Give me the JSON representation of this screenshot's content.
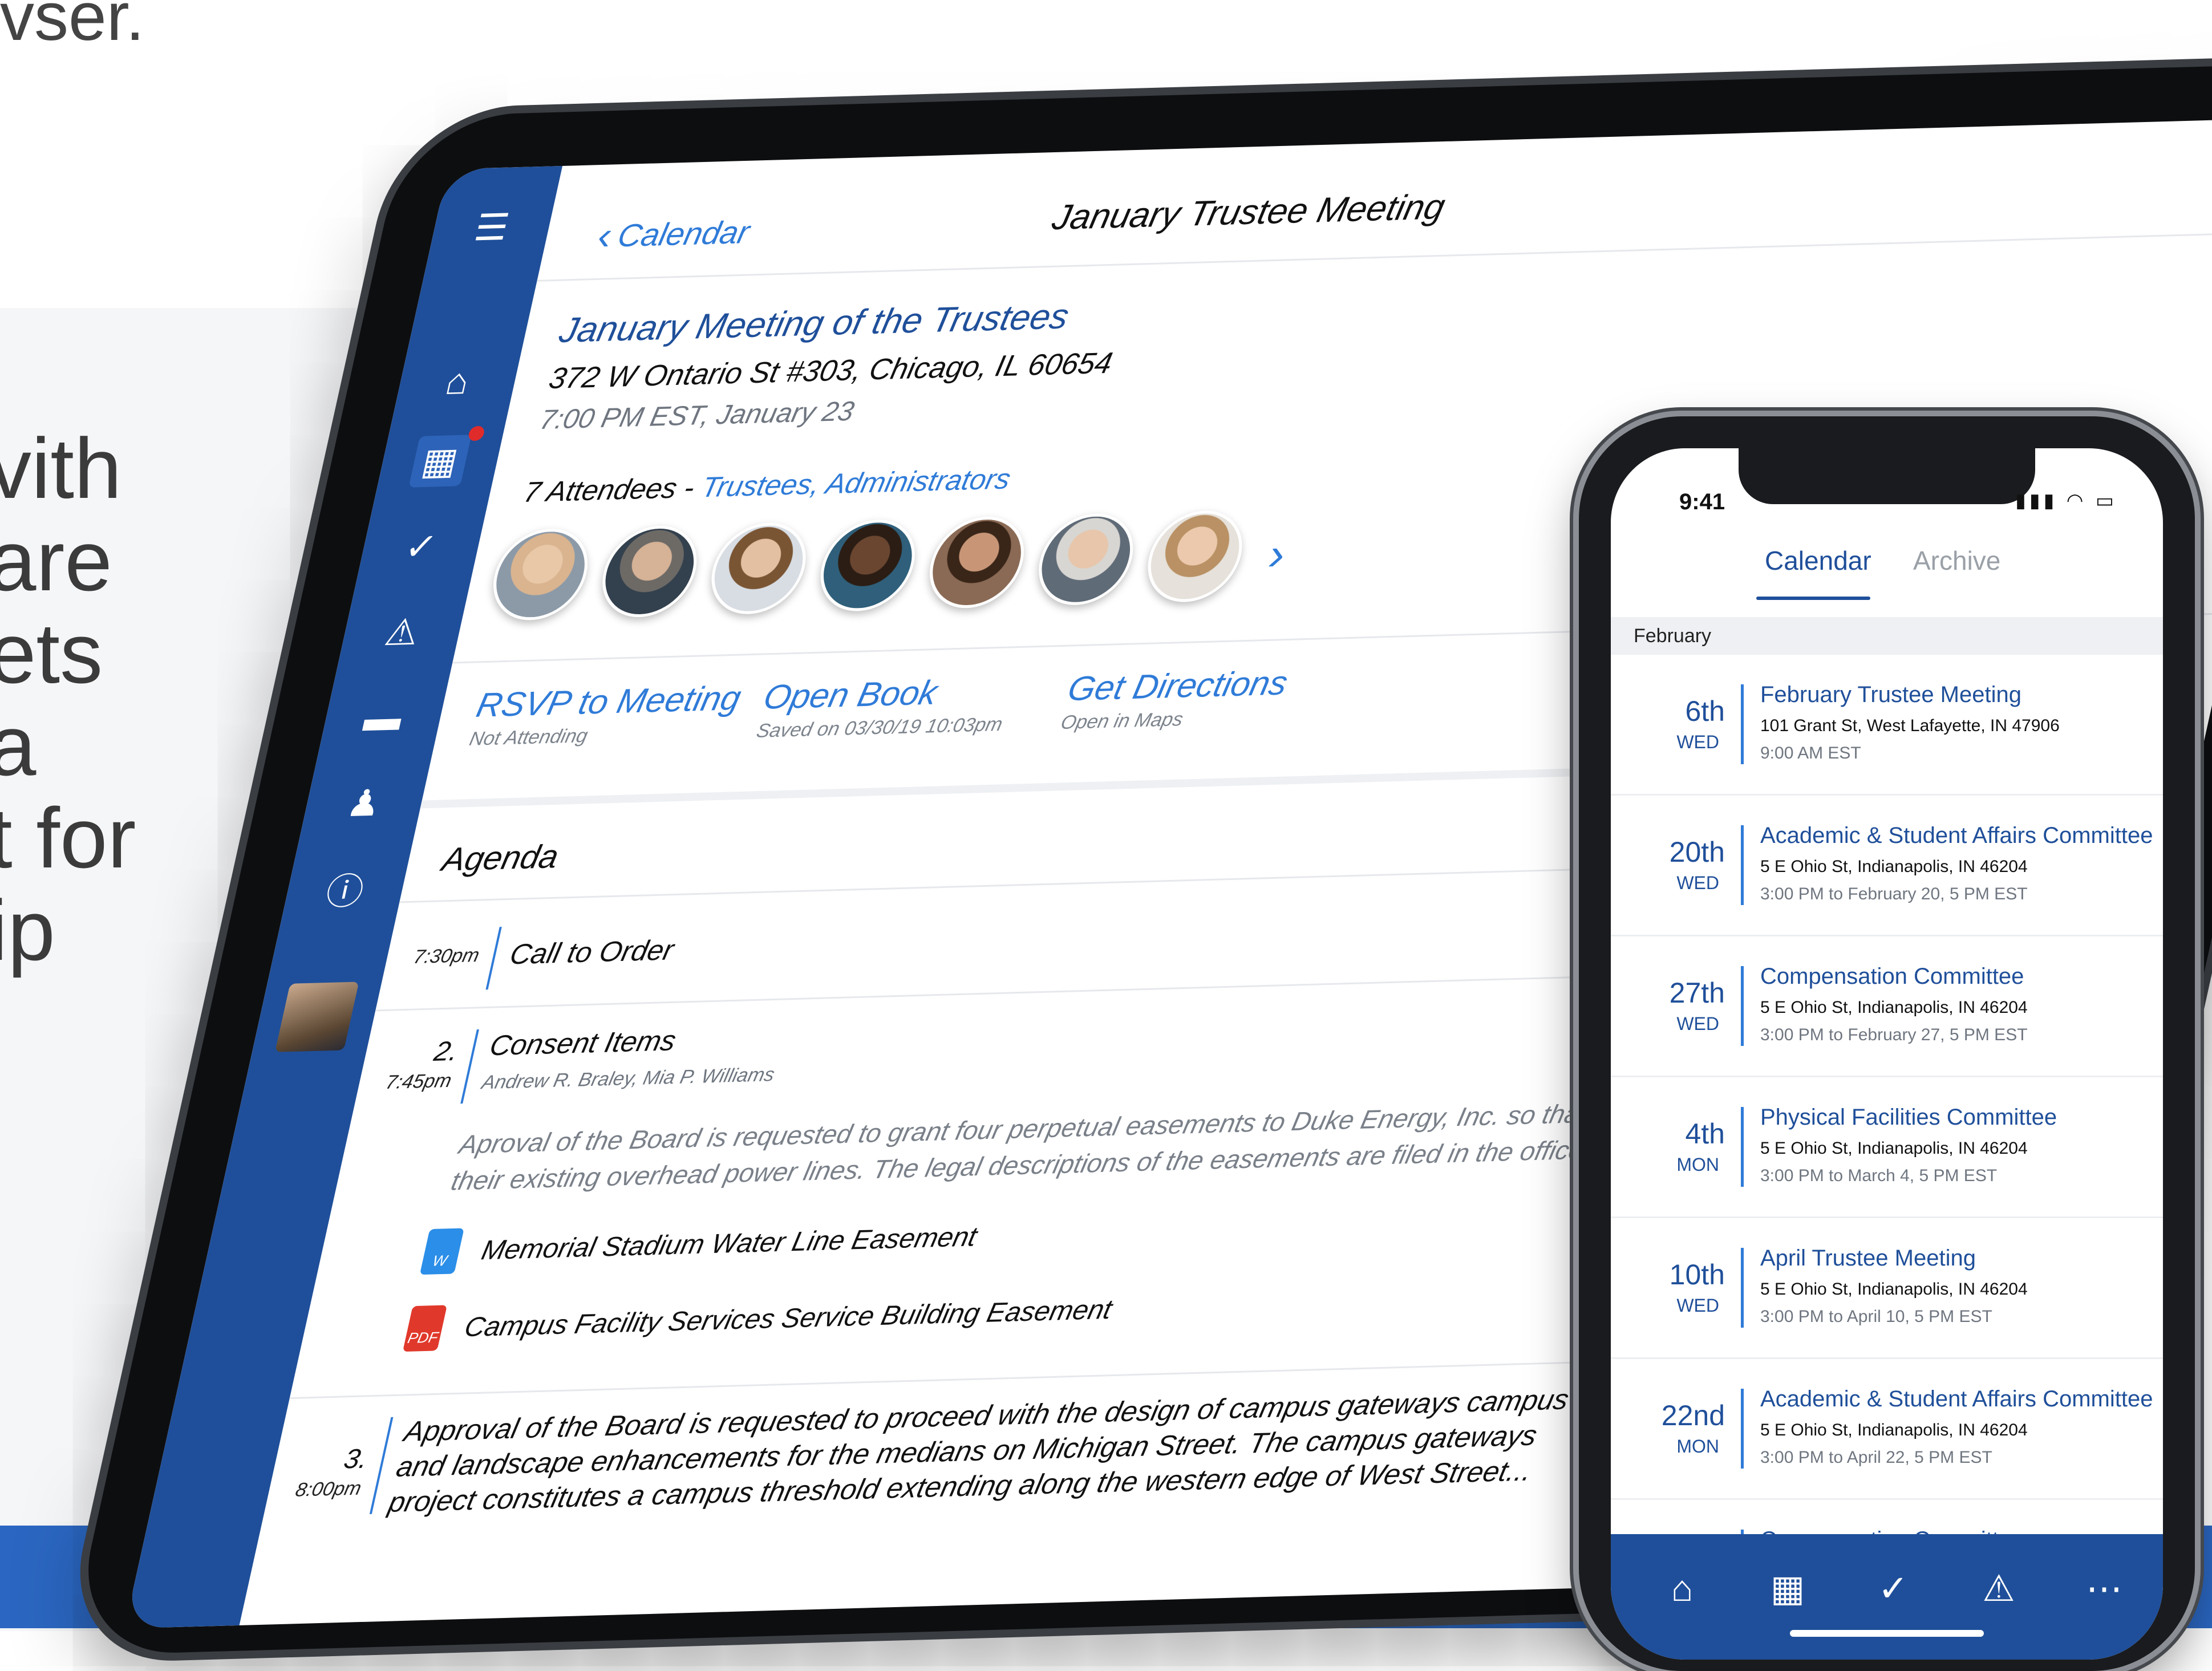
{
  "background": {
    "top_text": "vser.",
    "lines": [
      "vith",
      "are",
      "ets",
      "a",
      "t for",
      "ip"
    ]
  },
  "tablet": {
    "back_label": "Calendar",
    "page_title": "January Trustee Meeting",
    "meeting": {
      "title": "January Meeting of the Trustees",
      "address": "372 W Ontario St #303, Chicago, IL 60654",
      "time": "7:00 PM EST, January 23"
    },
    "attendees": {
      "count_text": "7 Attendees - ",
      "groups": "Trustees, Administrators"
    },
    "actions": [
      {
        "label": "RSVP to Meeting",
        "sub": "Not Attending"
      },
      {
        "label": "Open Book",
        "sub": "Saved on 03/30/19 10:03pm"
      },
      {
        "label": "Get Directions",
        "sub": "Open in Maps"
      }
    ],
    "agenda": {
      "heading": "Agenda",
      "item1": {
        "time": "7:30pm",
        "title": "Call to Order"
      },
      "item2": {
        "number": "2.",
        "time": "7:45pm",
        "title": "Consent Items",
        "people": "Andrew R. Braley, Mia P. Williams",
        "description": "Aproval of the Board is requested to grant four perpetual easements to Duke Energy, Inc. so that they of their existing overhead power lines. The legal descriptions of the easements are filed in the office...",
        "files": [
          {
            "type": "W",
            "name": "Memorial Stadium Water Line Easement"
          },
          {
            "type": "PDF",
            "name": "Campus Facility Services Service Building Easement"
          }
        ]
      },
      "item3": {
        "number": "3.",
        "time": "8:00pm",
        "text": "Approval of the Board is requested to proceed with the design of campus gateways campus and landscape enhancements for the medians on Michigan Street. The campus gateways project constitutes a campus threshold extending along the western edge of West Street..."
      }
    },
    "rail_icons": [
      "menu-icon",
      "home-icon",
      "calendar-icon",
      "check-icon",
      "alert-icon",
      "folder-icon",
      "person-icon",
      "info-icon"
    ]
  },
  "phone": {
    "status_time": "9:41",
    "tabs": {
      "active": "Calendar",
      "inactive": "Archive"
    },
    "month": "February",
    "events": [
      {
        "day": "6th",
        "dow": "WED",
        "title": "February Trustee Meeting",
        "address": "101 Grant St, West Lafayette, IN 47906",
        "time": "9:00 AM EST"
      },
      {
        "day": "20th",
        "dow": "WED",
        "title": "Academic & Student Affairs Committee",
        "address": "5 E Ohio St, Indianapolis, IN 46204",
        "time": "3:00 PM to February 20, 5 PM EST"
      },
      {
        "day": "27th",
        "dow": "WED",
        "title": "Compensation Committee",
        "address": "5 E Ohio St, Indianapolis, IN 46204",
        "time": "3:00 PM to February 27, 5 PM EST"
      },
      {
        "day": "4th",
        "dow": "MON",
        "title": "Physical Facilities Committee",
        "address": "5 E Ohio St, Indianapolis, IN 46204",
        "time": "3:00 PM to March 4, 5 PM EST"
      },
      {
        "day": "10th",
        "dow": "WED",
        "title": "April Trustee Meeting",
        "address": "5 E Ohio St, Indianapolis, IN 46204",
        "time": "3:00 PM to April 10, 5 PM EST"
      },
      {
        "day": "22nd",
        "dow": "MON",
        "title": "Academic & Student Affairs Committee",
        "address": "5 E Ohio St, Indianapolis, IN 46204",
        "time": "3:00 PM to April 22, 5 PM EST"
      },
      {
        "day": "",
        "dow": "",
        "title": "Compensation Committee",
        "address": "",
        "time": ""
      }
    ],
    "tabbar_icons": [
      "home-icon",
      "calendar-icon",
      "check-icon",
      "alert-icon",
      "more-icon"
    ]
  },
  "colors": {
    "brand_blue": "#1f4f9a",
    "link_blue": "#2f7bd8",
    "alert_red": "#e02b2b",
    "word_blue": "#2b8ee8",
    "pdf_red": "#e0392b"
  }
}
